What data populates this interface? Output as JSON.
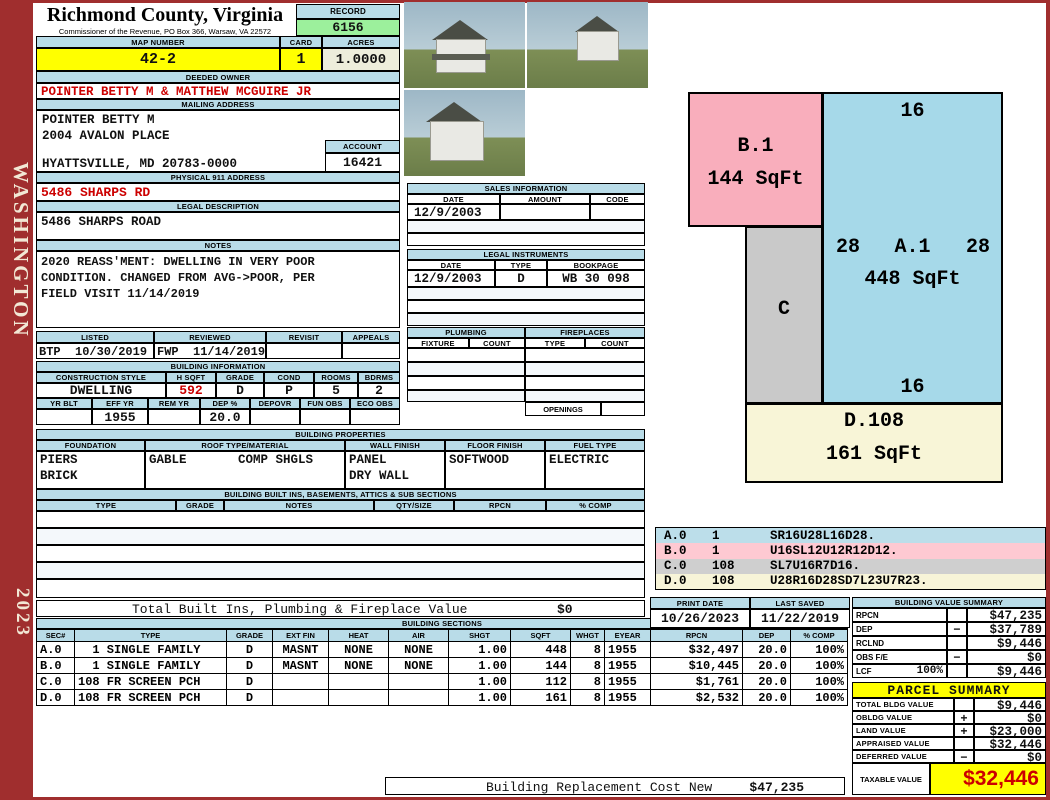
{
  "frame": {
    "state_vertical": "WASHINGTON",
    "year": "2023"
  },
  "header": {
    "county": "Richmond County, Virginia",
    "commissioner": "Commissioner of the Revenue, PO Box 366, Warsaw, VA 22572",
    "record_label": "RECORD",
    "record_value": "6156",
    "map_label": "MAP NUMBER",
    "map_value": "42-2",
    "card_label": "CARD",
    "card_value": "1",
    "acres_label": "ACRES",
    "acres_value": "1.0000"
  },
  "owner": {
    "label": "DEEDED OWNER",
    "name": "POINTER BETTY M & MATTHEW MCGUIRE JR"
  },
  "mailing": {
    "label": "MAILING ADDRESS",
    "line1": "POINTER BETTY M",
    "line2": "2004 AVALON PLACE",
    "line3": "HYATTSVILLE, MD 20783-0000",
    "account_label": "ACCOUNT",
    "account_value": "16421"
  },
  "physical": {
    "label": "PHYSICAL 911 ADDRESS",
    "value": "5486 SHARPS RD"
  },
  "legal": {
    "label": "LEGAL DESCRIPTION",
    "value": "5486 SHARPS ROAD"
  },
  "notes": {
    "label": "NOTES",
    "line1": "2020 REASS'MENT: DWELLING IN VERY POOR",
    "line2": "CONDITION. CHANGED FROM AVG->POOR, PER",
    "line3": "FIELD VISIT 11/14/2019"
  },
  "review": {
    "listed_label": "LISTED",
    "listed_value": "BTP  10/30/2019",
    "reviewed_label": "REVIEWED",
    "reviewed_value": "FWP  11/14/2019",
    "revisit_label": "REVISIT",
    "appeals_label": "APPEALS"
  },
  "building_info": {
    "title": "BUILDING INFORMATION",
    "style_label": "CONSTRUCTION STYLE",
    "style_value": "DWELLING",
    "hsqft_label": "H SQFT",
    "hsqft_value": "592",
    "grade_label": "GRADE",
    "grade_value": "D",
    "cond_label": "COND",
    "cond_value": "P",
    "rooms_label": "ROOMS",
    "rooms_value": "5",
    "bdrms_label": "BDRMS",
    "bdrms_value": "2",
    "yrblt_label": "YR BLT",
    "effyr_label": "EFF YR",
    "effyr_value": "1955",
    "remyr_label": "REM YR",
    "dep_label": "DEP %",
    "dep_value": "20.0",
    "depovr_label": "DEPOVR",
    "funobs_label": "FUN OBS",
    "ecoobs_label": "ECO OBS"
  },
  "building_props": {
    "title": "BUILDING PROPERTIES",
    "foundation_label": "FOUNDATION",
    "foundation1": "PIERS",
    "foundation2": "BRICK",
    "roof_label": "ROOF TYPE/MATERIAL",
    "roof1": "GABLE",
    "roof2": "COMP SHGLS",
    "wall_label": "WALL FINISH",
    "wall1": "PANEL",
    "wall2": "DRY WALL",
    "floor_label": "FLOOR FINISH",
    "floor1": "SOFTWOOD",
    "fuel_label": "FUEL TYPE",
    "fuel1": "ELECTRIC"
  },
  "built_ins": {
    "title": "BUILDING BUILT INS, BASEMENTS, ATTICS & SUB SECTIONS",
    "headers": [
      "TYPE",
      "GRADE",
      "NOTES",
      "QTY/SIZE",
      "RPCN",
      "% COMP"
    ],
    "total_label": "Total Built Ins, Plumbing & Fireplace Value",
    "total_value": "$0"
  },
  "building_sections": {
    "title": "BUILDING SECTIONS",
    "headers": [
      "SEC#",
      "TYPE",
      "GRADE",
      "EXT FIN",
      "HEAT",
      "AIR",
      "SHGT",
      "SQFT",
      "WHGT",
      "EYEAR",
      "RPCN",
      "DEP",
      "% COMP"
    ],
    "rows": [
      {
        "sec": "A.0",
        "type": "  1 SINGLE FAMILY",
        "grade": "D",
        "ext": "MASNT",
        "heat": "NONE",
        "air": "NONE",
        "shgt": "1.00",
        "sqft": "448",
        "whgt": "8",
        "eyear": "1955",
        "rpcn": "$32,497",
        "dep": "20.0",
        "comp": "100%"
      },
      {
        "sec": "B.0",
        "type": "  1 SINGLE FAMILY",
        "grade": "D",
        "ext": "MASNT",
        "heat": "NONE",
        "air": "NONE",
        "shgt": "1.00",
        "sqft": "144",
        "whgt": "8",
        "eyear": "1955",
        "rpcn": "$10,445",
        "dep": "20.0",
        "comp": "100%"
      },
      {
        "sec": "C.0",
        "type": "108 FR SCREEN PCH",
        "grade": "D",
        "ext": "",
        "heat": "",
        "air": "",
        "shgt": "1.00",
        "sqft": "112",
        "whgt": "8",
        "eyear": "1955",
        "rpcn": "$1,761",
        "dep": "20.0",
        "comp": "100%"
      },
      {
        "sec": "D.0",
        "type": "108 FR SCREEN PCH",
        "grade": "D",
        "ext": "",
        "heat": "",
        "air": "",
        "shgt": "1.00",
        "sqft": "161",
        "whgt": "8",
        "eyear": "1955",
        "rpcn": "$2,532",
        "dep": "20.0",
        "comp": "100%"
      }
    ]
  },
  "replacement": {
    "label": "Building Replacement Cost New",
    "value": "$47,235"
  },
  "sales": {
    "title": "SALES INFORMATION",
    "date_label": "DATE",
    "amount_label": "AMOUNT",
    "code_label": "CODE",
    "row_date": "12/9/2003"
  },
  "instruments": {
    "title": "LEGAL INSTRUMENTS",
    "date_label": "DATE",
    "type_label": "TYPE",
    "book_label": "BOOKPAGE",
    "row_date": "12/9/2003",
    "row_type": "D",
    "row_book": "WB 30 098"
  },
  "plumbing": {
    "title": "PLUMBING",
    "fixture_label": "FIXTURE",
    "count_label": "COUNT"
  },
  "fireplaces": {
    "title": "FIREPLACES",
    "type_label": "TYPE",
    "count_label": "COUNT",
    "openings_label": "OPENINGS"
  },
  "sketch": {
    "b_label": "B.1",
    "b_sqft": "144 SqFt",
    "a_dim_top": "16",
    "a_dim_left": "28",
    "a_label": "A.1",
    "a_dim_right": "28",
    "a_sqft": "448 SqFt",
    "a_dim_bottom": "16",
    "c_label": "C",
    "d_label": "D.108",
    "d_sqft": "161 SqFt",
    "legend": [
      {
        "sec": "A.0",
        "num": "1",
        "trace": "SR16U28L16D28."
      },
      {
        "sec": "B.0",
        "num": "1",
        "trace": "U16SL12U12R12D12."
      },
      {
        "sec": "C.0",
        "num": "108",
        "trace": "SL7U16R7D16."
      },
      {
        "sec": "D.0",
        "num": "108",
        "trace": "U28R16D28SD7L23U7R23."
      }
    ]
  },
  "dates": {
    "print_label": "PRINT DATE",
    "print_value": "10/26/2023",
    "saved_label": "LAST SAVED",
    "saved_value": "11/22/2019"
  },
  "value_summary": {
    "title": "BUILDING VALUE SUMMARY",
    "rows": [
      {
        "label": "RPCN",
        "pct": "",
        "op": "",
        "value": "$47,235"
      },
      {
        "label": "DEP",
        "pct": "",
        "op": "−",
        "value": "$37,789"
      },
      {
        "label": "RCLND",
        "pct": "",
        "op": "",
        "value": "$9,446"
      },
      {
        "label": "OBS F/E",
        "pct": "",
        "op": "−",
        "value": "$0"
      },
      {
        "label": "LCF",
        "pct": "100%",
        "op": "",
        "value": "$9,446"
      }
    ]
  },
  "parcel_summary": {
    "title": "PARCEL SUMMARY",
    "rows": [
      {
        "label": "TOTAL BLDG VALUE",
        "op": "",
        "value": "$9,446"
      },
      {
        "label": "OBLDG VALUE",
        "op": "+",
        "value": "$0"
      },
      {
        "label": "LAND VALUE",
        "op": "+",
        "value": "$23,000"
      },
      {
        "label": "APPRAISED VALUE",
        "op": "",
        "value": "$32,446"
      },
      {
        "label": "DEFERRED VALUE",
        "op": "−",
        "value": "$0"
      }
    ],
    "taxable_label": "TAXABLE VALUE",
    "taxable_value": "$32,446"
  },
  "colors": {
    "frame_red": "#A02E2E",
    "header_blue": "#B9DCE8",
    "record_green": "#9CF09C",
    "highlight_yellow": "#FFFF00",
    "value_beige": "#EDEDDB",
    "accent_red": "#CC0000",
    "sketch_pink": "#F9AEBC",
    "sketch_blue": "#A6D9E9",
    "sketch_gray": "#C9C9C9",
    "sketch_cream": "#F8F5D7"
  }
}
